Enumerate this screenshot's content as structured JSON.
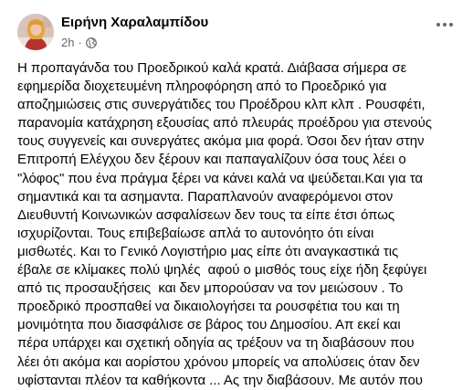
{
  "post": {
    "author": {
      "name": "Ειρήνη Χαραλαμπίδου",
      "avatar_icon": "profile-photo"
    },
    "meta": {
      "timestamp": "2h",
      "separator": "·",
      "audience_icon": "globe-icon"
    },
    "more_icon": "ellipsis-icon",
    "text_lines": [
      "Η προπαγάνδα του Προεδρικού καλά κρατά. Διάβασα σήμερα σε",
      "εφημερίδα διοχετευμένη πληροφόρηση από το Προεδρικό για",
      "αποζημιώσεις στις συνεργάτιδες του Προέδρου κλπ κλπ . Ρουσφέτι,",
      "παρανομία κατάχρηση εξουσίας από πλευράς προέδρου για στενούς",
      "τους συγγενείς και συνεργάτες ακόμα μια φορά. Όσοι δεν ήταν στην",
      "Επιτροπή Ελέγχου δεν ξέρουν και παπαγαλίζουν όσα τους λέει ο",
      "\"λόφος\" που ένα πράγμα ξέρει να κάνει καλά να ψεύδεται.Και για τα",
      "σημαντικά και τα ασημαντα. Παραπλανούν αναφερόμενοι στον",
      "Διευθυντή Κοινωνικών ασφαλίσεων δεν τους τα είπε έτσι όπως",
      "ισχυρίζονται. Τους επιβεβαίωσε απλά το αυτονόητο ότι είναι",
      "μισθωτές. Και το Γενικό Λογιστήριο μας είπε ότι αναγκαστικά τις",
      "έβαλε σε κλίμακες πολύ ψηλές  αφού ο μισθός τους είχε ήδη ξεφύγει",
      "από τις προσαυξήσεις  και δεν μπορούσαν να τον μειώσουν . Το",
      "προεδρικό προσπαθεί να δικαιολογήσει τα ρουσφέτια του και τη",
      "μονιμότητα που διασφάλισε σε βάρος του Δημοσίου. Απ εκεί και",
      "πέρα υπάρχει και σχετική οδηγία ας τρέξουν να τη διαβάσουν που",
      "λέει ότι ακόμα και αορίστου χρόνου μπορείς να απολύσεις όταν δεν",
      "υφίστανται πλέον τα καθήκοντα ... Ας την διαβάσουν. Με αυτόν που"
    ]
  }
}
